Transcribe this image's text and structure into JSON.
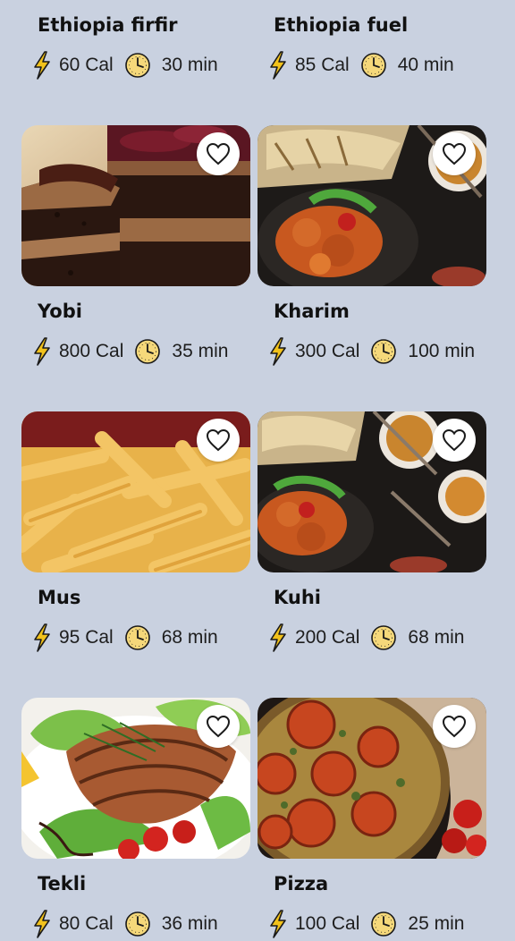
{
  "recipes": [
    {
      "name": "Ethiopia firfir",
      "calories": "60 Cal",
      "time": "30 min",
      "photo": "partial-top"
    },
    {
      "name": "Ethiopia fuel",
      "calories": "85 Cal",
      "time": "40 min",
      "photo": "partial-top"
    },
    {
      "name": "Yobi",
      "calories": "800 Cal",
      "time": "35 min",
      "photo": "chocolate-cake"
    },
    {
      "name": "Kharim",
      "calories": "300 Cal",
      "time": "100 min",
      "photo": "curry-platter"
    },
    {
      "name": "Mus",
      "calories": "95 Cal",
      "time": "68 min",
      "photo": "french-fries"
    },
    {
      "name": "Kuhi",
      "calories": "200 Cal",
      "time": "68 min",
      "photo": "curry-bowls"
    },
    {
      "name": "Tekli",
      "calories": "80 Cal",
      "time": "36 min",
      "photo": "grilled-salmon"
    },
    {
      "name": "Pizza",
      "calories": "100 Cal",
      "time": "25 min",
      "photo": "tomato-pizza"
    }
  ],
  "icons": {
    "calorie": "lightning-bolt-icon",
    "time": "clock-icon",
    "favorite": "heart-outline-icon"
  },
  "colors": {
    "background": "#c9d1e0",
    "bolt": "#f2c21b",
    "clock": "#f5d87a",
    "card": "#ffffff"
  }
}
